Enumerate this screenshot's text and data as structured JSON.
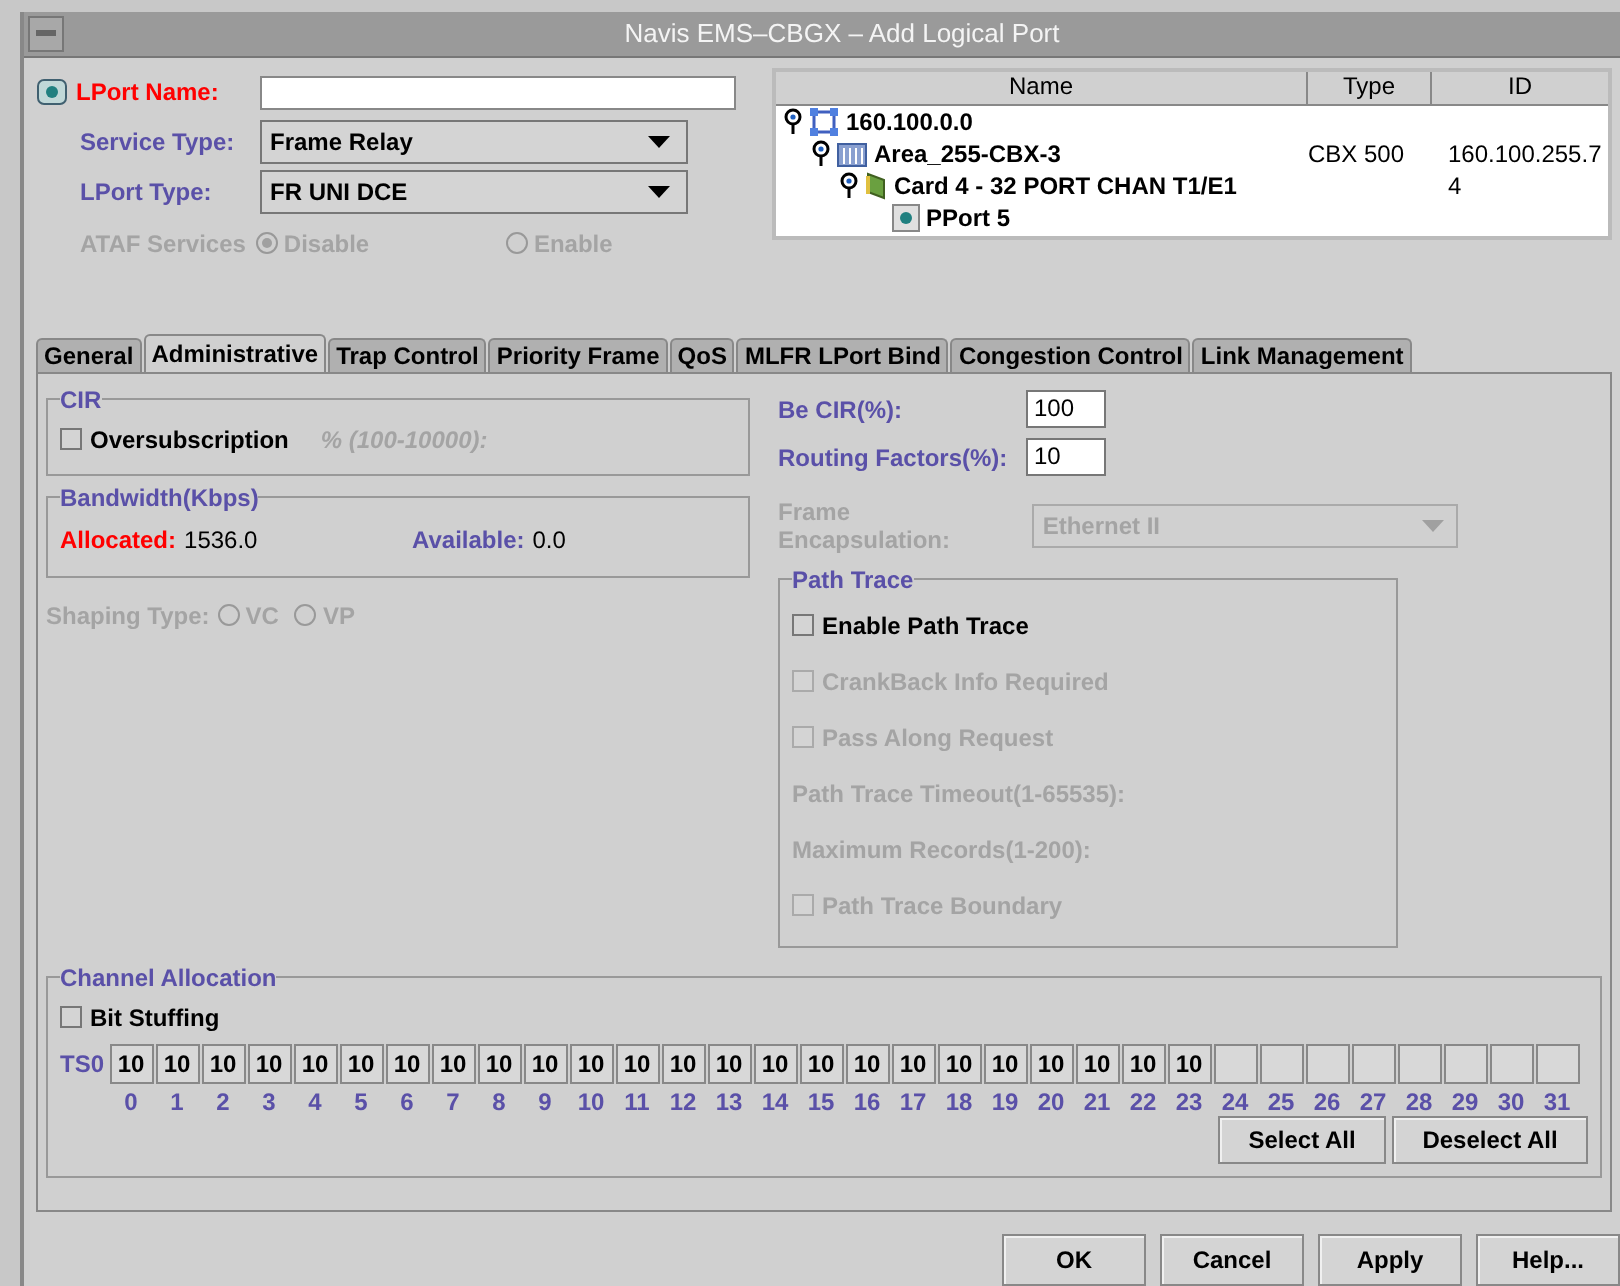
{
  "window": {
    "title": "Navis EMS–CBGX – Add Logical Port"
  },
  "fields": [
    {
      "kind": "text",
      "label": "LPort Name:",
      "required": true
    },
    {
      "kind": "dropdown",
      "label": "Service Type:",
      "value": "Frame Relay",
      "required": false
    },
    {
      "kind": "dropdown",
      "label": "LPort Type:",
      "value": "FR UNI DCE",
      "required": false
    }
  ],
  "ataf": {
    "label": "ATAF Services",
    "disabled": true,
    "options": [
      {
        "label": "Disable",
        "selected": true
      },
      {
        "label": "Enable",
        "selected": false
      }
    ]
  },
  "tree": {
    "columns": [
      "Name",
      "Type",
      "ID"
    ],
    "rows": [
      {
        "name": "160.100.0.0",
        "kind": "network",
        "children": [
          {
            "name": "Area_255-CBX-3",
            "type": "CBX 500",
            "id": "160.100.255.7",
            "kind": "switch",
            "children": [
              {
                "name": "Card 4 - 32 PORT CHAN T1/E1",
                "id": "4",
                "kind": "card",
                "children": [
                  {
                    "name": "PPort 5",
                    "kind": "port"
                  }
                ]
              }
            ]
          }
        ]
      }
    ]
  },
  "tabs": [
    {
      "label": "General",
      "selected": false
    },
    {
      "label": "Administrative",
      "selected": true
    },
    {
      "label": "Trap Control",
      "selected": false
    },
    {
      "label": "Priority Frame",
      "selected": false
    },
    {
      "label": "QoS",
      "selected": false
    },
    {
      "label": "MLFR LPort Bind",
      "selected": false
    },
    {
      "label": "Congestion Control",
      "selected": false
    },
    {
      "label": "Link Management",
      "selected": false
    }
  ],
  "cir": {
    "title": "CIR",
    "oversubscription": {
      "label": "Oversubscription",
      "checked": false
    },
    "hint": "% (100-10000):"
  },
  "bandwidth": {
    "title": "Bandwidth(Kbps)",
    "allocated": {
      "label": "Allocated:",
      "value": "1536.0"
    },
    "available": {
      "label": "Available:",
      "value": "0.0"
    }
  },
  "shaping": {
    "label": "Shaping Type:",
    "disabled": true,
    "options": [
      {
        "label": "VC",
        "selected": false
      },
      {
        "label": "VP",
        "selected": false
      }
    ]
  },
  "be_cir": {
    "label": "Be CIR(%):",
    "value": "100"
  },
  "routing_factors": {
    "label": "Routing Factors(%):",
    "value": "10"
  },
  "frame_encapsulation": {
    "label": "Frame Encapsulation:",
    "value": "Ethernet II",
    "disabled": true
  },
  "path_trace": {
    "title": "Path Trace",
    "rows": [
      {
        "kind": "checkbox",
        "label": "Enable Path Trace",
        "checked": false,
        "disabled": false
      },
      {
        "kind": "checkbox",
        "label": "CrankBack Info Required",
        "checked": false,
        "disabled": true
      },
      {
        "kind": "checkbox",
        "label": "Pass Along Request",
        "checked": false,
        "disabled": true
      },
      {
        "kind": "label",
        "label": "Path Trace Timeout(1-65535):",
        "disabled": true
      },
      {
        "kind": "label",
        "label": "Maximum Records(1-200):",
        "disabled": true
      },
      {
        "kind": "checkbox",
        "label": "Path Trace Boundary",
        "checked": false,
        "disabled": true
      }
    ]
  },
  "channel_allocation": {
    "title": "Channel Allocation",
    "bit_stuffing": {
      "label": "Bit Stuffing",
      "checked": false
    },
    "row_label": "TS0",
    "slots": [
      {
        "index": "0",
        "value": "10"
      },
      {
        "index": "1",
        "value": "10"
      },
      {
        "index": "2",
        "value": "10"
      },
      {
        "index": "3",
        "value": "10"
      },
      {
        "index": "4",
        "value": "10"
      },
      {
        "index": "5",
        "value": "10"
      },
      {
        "index": "6",
        "value": "10"
      },
      {
        "index": "7",
        "value": "10"
      },
      {
        "index": "8",
        "value": "10"
      },
      {
        "index": "9",
        "value": "10"
      },
      {
        "index": "10",
        "value": "10"
      },
      {
        "index": "11",
        "value": "10"
      },
      {
        "index": "12",
        "value": "10"
      },
      {
        "index": "13",
        "value": "10"
      },
      {
        "index": "14",
        "value": "10"
      },
      {
        "index": "15",
        "value": "10"
      },
      {
        "index": "16",
        "value": "10"
      },
      {
        "index": "17",
        "value": "10"
      },
      {
        "index": "18",
        "value": "10"
      },
      {
        "index": "19",
        "value": "10"
      },
      {
        "index": "20",
        "value": "10"
      },
      {
        "index": "21",
        "value": "10"
      },
      {
        "index": "22",
        "value": "10"
      },
      {
        "index": "23",
        "value": "10"
      },
      {
        "index": "24"
      },
      {
        "index": "25"
      },
      {
        "index": "26"
      },
      {
        "index": "27"
      },
      {
        "index": "28"
      },
      {
        "index": "29"
      },
      {
        "index": "30"
      },
      {
        "index": "31"
      }
    ],
    "buttons": [
      "Select All",
      "Deselect All"
    ]
  },
  "buttons": [
    "OK",
    "Cancel",
    "Apply",
    "Help..."
  ]
}
